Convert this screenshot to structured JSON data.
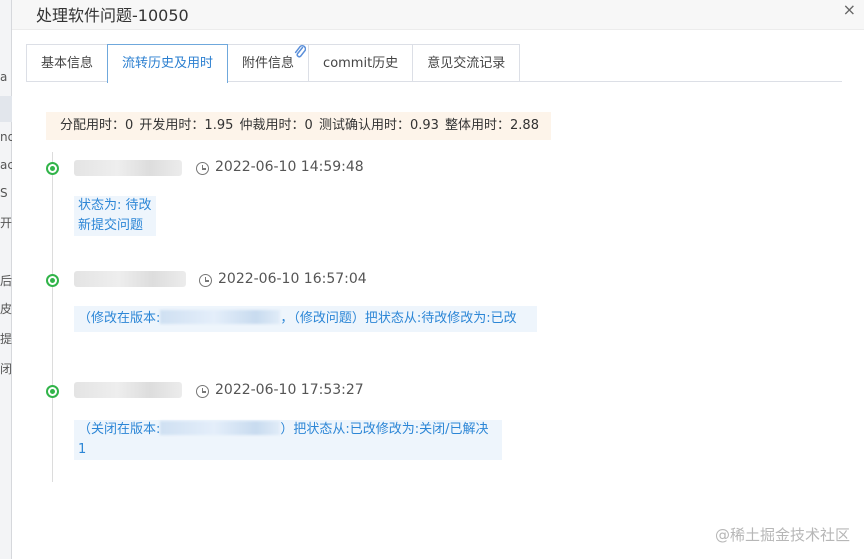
{
  "dialog": {
    "title": "处理软件问题-10050",
    "close": "×"
  },
  "tabs": [
    {
      "label": "基本信息",
      "active": false
    },
    {
      "label": "流转历史及用时",
      "active": true
    },
    {
      "label": "附件信息",
      "active": false,
      "icon": "paperclip-icon"
    },
    {
      "label": "commit历史",
      "active": false
    },
    {
      "label": "意见交流记录",
      "active": false
    }
  ],
  "summary": {
    "assign": "分配用时：0",
    "develop": "开发用时：1.95",
    "arbitrate": "仲裁用时：0",
    "test": "测试确认用时：0.93",
    "total": "整体用时：2.88"
  },
  "timeline": [
    {
      "time": "2022-06-10 14:59:48",
      "lines": [
        "状态为: 待改",
        "新提交问题"
      ]
    },
    {
      "time": "2022-06-10 16:57:04",
      "msg_before": "（修改在版本:",
      "msg_after": "，（修改问题）把状态从:待改修改为:已改"
    },
    {
      "time": "2022-06-10 17:53:27",
      "msg_before": "（关闭在版本:",
      "msg_after": "）把状态从:已改修改为:关闭/已解决",
      "msg_line2": "1"
    }
  ],
  "backdrop": {
    "fragments": [
      "a",
      "nd",
      "ac",
      "S",
      "开",
      "后",
      "皮",
      "提",
      "闭"
    ]
  },
  "watermark": "@稀土掘金技术社区",
  "colors": {
    "accent": "#2b7fd0",
    "node": "#32b44a",
    "summary_bg": "#fdf4ea",
    "message_bg": "#eef5fc"
  }
}
